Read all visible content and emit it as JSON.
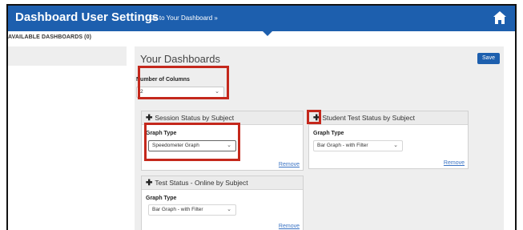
{
  "header": {
    "title": "Dashboard User Settings",
    "goto_link": "Go to Your Dashboard »"
  },
  "sidebar": {
    "heading": "AVAILABLE DASHBOARDS (0)"
  },
  "main": {
    "title": "Your Dashboards",
    "save_label": "Save",
    "columns": {
      "label": "Number of Columns",
      "value": "2"
    }
  },
  "cards": [
    {
      "title": "Session Status by Subject",
      "graph_type_label": "Graph Type",
      "graph_type_value": "Speedometer Graph",
      "remove_label": "Remove"
    },
    {
      "title": "Student Test Status by Subject",
      "graph_type_label": "Graph Type",
      "graph_type_value": "Bar Graph - with Filter",
      "remove_label": "Remove"
    },
    {
      "title": "Test Status - Online by Subject",
      "graph_type_label": "Graph Type",
      "graph_type_value": "Bar Graph - with Filter",
      "remove_label": "Remove"
    }
  ],
  "icons": {
    "home": "home-icon",
    "move": "move-icon",
    "chevron": "chevron-down-icon"
  },
  "colors": {
    "brand": "#1d5fae",
    "highlight": "#c4281c",
    "link": "#3a73c4"
  }
}
